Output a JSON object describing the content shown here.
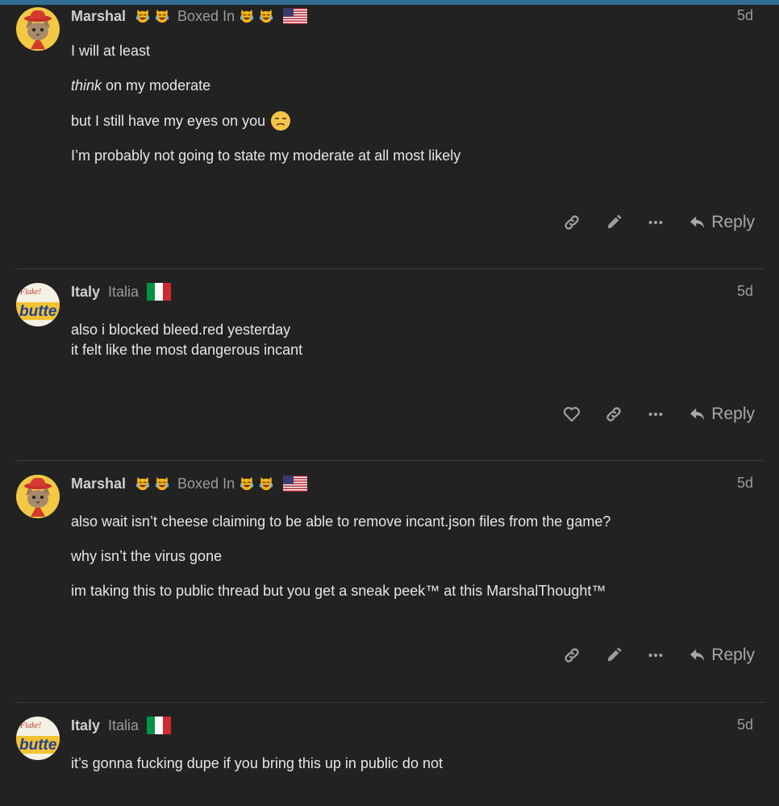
{
  "posts": [
    {
      "username": "Marshal",
      "user_title": "Boxed In",
      "date": "5d",
      "avatar": "cowboy-cat",
      "title_emoji": "joy-cat-icon",
      "flag": "us-flag-icon",
      "paragraphs": [
        {
          "text": "I will at least"
        },
        {
          "em": "think",
          "text": " on my moderate"
        },
        {
          "text": "but I still have my eyes on you"
        },
        {
          "text": "I’m probably not going to state my moderate at all most likely"
        }
      ],
      "actions": {
        "reply_label": "Reply"
      }
    },
    {
      "username": "Italy",
      "user_title": "Italia",
      "date": "5d",
      "avatar": "butter-logo",
      "flag": "italy-flag-icon",
      "lines": [
        "also i blocked bleed.red yesterday",
        "it felt like the most dangerous incant"
      ],
      "actions": {
        "reply_label": "Reply"
      }
    },
    {
      "username": "Marshal",
      "user_title": "Boxed In",
      "date": "5d",
      "avatar": "cowboy-cat",
      "paragraphs": [
        {
          "text": "also wait isn’t cheese claiming to be able to remove incant.json files from the game?"
        },
        {
          "text": "why isn’t the virus gone"
        },
        {
          "text": "im taking this to public thread but you get a sneak peek™ at this MarshalThought™"
        }
      ],
      "actions": {
        "reply_label": "Reply"
      }
    },
    {
      "username": "Italy",
      "user_title": "Italia",
      "date": "5d",
      "avatar": "butter-logo",
      "paragraphs": [
        {
          "text": "it’s gonna fucking dupe if you bring this up in public do not"
        }
      ]
    }
  ],
  "colors": {
    "background": "#222222",
    "accent_bar": "#2f6e91",
    "text": "#e6e6e6",
    "muted": "#9b9b9b"
  },
  "avatar_text": {
    "butter_small": "Flake!",
    "butter_big": "butte"
  }
}
